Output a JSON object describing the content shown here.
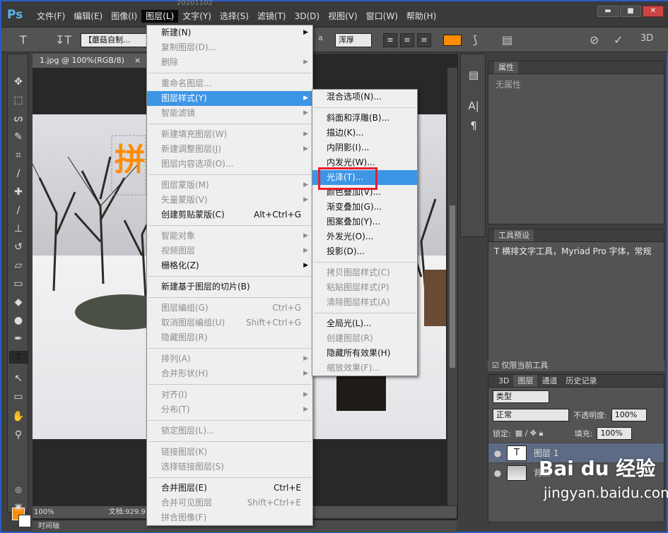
{
  "app": {
    "logo": "Ps",
    "file_ghost": "20201102"
  },
  "menubar": [
    "文件(F)",
    "编辑(E)",
    "图像(I)",
    "图层(L)",
    "文字(Y)",
    "选择(S)",
    "滤镜(T)",
    "3D(D)",
    "视图(V)",
    "窗口(W)",
    "帮助(H)"
  ],
  "window_buttons": {
    "minimize": "▬",
    "maximize": "■",
    "close": "✕"
  },
  "options": {
    "font_family": "【蘑菇自制...",
    "aa_method": "浑厚",
    "aa_label": "a",
    "swatch_color": "#ff8c00",
    "threed_label": "3D"
  },
  "document": {
    "tab_title": "1.jpg @ 100%(RGB/8)",
    "tab_close": "×",
    "canvas_text": "拼"
  },
  "status": {
    "zoom": "100%",
    "doc_info": "文档:929.9"
  },
  "timeline_label": "时间轴",
  "layer_menu": {
    "items": [
      {
        "label": "新建(N)",
        "shortcut": "",
        "arrow": true,
        "disabled": false
      },
      {
        "label": "复制图层(D)...",
        "shortcut": "",
        "arrow": false,
        "disabled": true
      },
      {
        "label": "删除",
        "shortcut": "",
        "arrow": true,
        "disabled": true
      },
      {
        "sep": true
      },
      {
        "label": "重命名图层...",
        "shortcut": "",
        "arrow": false,
        "disabled": true
      },
      {
        "label": "图层样式(Y)",
        "shortcut": "",
        "arrow": true,
        "disabled": false,
        "highlight": true
      },
      {
        "label": "智能滤镜",
        "shortcut": "",
        "arrow": true,
        "disabled": true
      },
      {
        "sep": true
      },
      {
        "label": "新建填充图层(W)",
        "shortcut": "",
        "arrow": true,
        "disabled": true
      },
      {
        "label": "新建调整图层(J)",
        "shortcut": "",
        "arrow": true,
        "disabled": true
      },
      {
        "label": "图层内容选项(O)...",
        "shortcut": "",
        "arrow": false,
        "disabled": true
      },
      {
        "sep": true
      },
      {
        "label": "图层蒙版(M)",
        "shortcut": "",
        "arrow": true,
        "disabled": true
      },
      {
        "label": "矢量蒙版(V)",
        "shortcut": "",
        "arrow": true,
        "disabled": true
      },
      {
        "label": "创建剪贴蒙版(C)",
        "shortcut": "Alt+Ctrl+G",
        "arrow": false,
        "disabled": false
      },
      {
        "sep": true
      },
      {
        "label": "智能对象",
        "shortcut": "",
        "arrow": true,
        "disabled": true
      },
      {
        "label": "视频图层",
        "shortcut": "",
        "arrow": true,
        "disabled": true
      },
      {
        "label": "栅格化(Z)",
        "shortcut": "",
        "arrow": true,
        "disabled": false
      },
      {
        "sep": true
      },
      {
        "label": "新建基于图层的切片(B)",
        "shortcut": "",
        "arrow": false,
        "disabled": false
      },
      {
        "sep": true
      },
      {
        "label": "图层编组(G)",
        "shortcut": "Ctrl+G",
        "arrow": false,
        "disabled": true
      },
      {
        "label": "取消图层编组(U)",
        "shortcut": "Shift+Ctrl+G",
        "arrow": false,
        "disabled": true
      },
      {
        "label": "隐藏图层(R)",
        "shortcut": "",
        "arrow": false,
        "disabled": true
      },
      {
        "sep": true
      },
      {
        "label": "排列(A)",
        "shortcut": "",
        "arrow": true,
        "disabled": true
      },
      {
        "label": "合并形状(H)",
        "shortcut": "",
        "arrow": true,
        "disabled": true
      },
      {
        "sep": true
      },
      {
        "label": "对齐(I)",
        "shortcut": "",
        "arrow": true,
        "disabled": true
      },
      {
        "label": "分布(T)",
        "shortcut": "",
        "arrow": true,
        "disabled": true
      },
      {
        "sep": true
      },
      {
        "label": "锁定图层(L)...",
        "shortcut": "",
        "arrow": false,
        "disabled": true
      },
      {
        "sep": true
      },
      {
        "label": "链接图层(K)",
        "shortcut": "",
        "arrow": false,
        "disabled": true
      },
      {
        "label": "选择链接图层(S)",
        "shortcut": "",
        "arrow": false,
        "disabled": true
      },
      {
        "sep": true
      },
      {
        "label": "合并图层(E)",
        "shortcut": "Ctrl+E",
        "arrow": false,
        "disabled": false
      },
      {
        "label": "合并可见图层",
        "shortcut": "Shift+Ctrl+E",
        "arrow": false,
        "disabled": true
      },
      {
        "label": "拼合图像(F)",
        "shortcut": "",
        "arrow": false,
        "disabled": true
      }
    ]
  },
  "style_submenu": {
    "items": [
      {
        "label": "混合选项(N)...",
        "disabled": false
      },
      {
        "sep": true
      },
      {
        "label": "斜面和浮雕(B)...",
        "disabled": false
      },
      {
        "label": "描边(K)...",
        "disabled": false
      },
      {
        "label": "内阴影(I)...",
        "disabled": false
      },
      {
        "label": "内发光(W)...",
        "disabled": false
      },
      {
        "label": "光泽(T)...",
        "disabled": false,
        "highlight": true
      },
      {
        "label": "颜色叠加(V)...",
        "disabled": false
      },
      {
        "label": "渐变叠加(G)...",
        "disabled": false
      },
      {
        "label": "图案叠加(Y)...",
        "disabled": false
      },
      {
        "label": "外发光(O)...",
        "disabled": false
      },
      {
        "label": "投影(D)...",
        "disabled": false
      },
      {
        "sep": true
      },
      {
        "label": "拷贝图层样式(C)",
        "disabled": true
      },
      {
        "label": "粘贴图层样式(P)",
        "disabled": true
      },
      {
        "label": "清除图层样式(A)",
        "disabled": true
      },
      {
        "sep": true
      },
      {
        "label": "全局光(L)...",
        "disabled": false
      },
      {
        "label": "创建图层(R)",
        "disabled": true
      },
      {
        "label": "隐藏所有效果(H)",
        "disabled": false
      },
      {
        "label": "缩放效果(F)...",
        "disabled": true
      }
    ]
  },
  "properties_panel": {
    "title": "属性",
    "empty_text": "无属性"
  },
  "presets_panel": {
    "title": "工具预设",
    "row_icon": "T",
    "row_text": "横排文字工具，Myriad Pro 字体，常规"
  },
  "presets_footer": {
    "checkbox_label": "仅限当前工具"
  },
  "layers_panel": {
    "tabs": [
      "3D",
      "图层",
      "通道",
      "历史记录"
    ],
    "filter_label": "类型",
    "blend_mode": "正常",
    "opacity_label": "不透明度:",
    "opacity_value": "100%",
    "lock_label": "锁定:",
    "fill_label": "填充:",
    "fill_value": "100%",
    "layers": [
      {
        "name": "图层 1",
        "thumb": "T",
        "active": true
      },
      {
        "name": "背景",
        "thumb": "",
        "active": false
      }
    ]
  },
  "watermark": {
    "brand": "Bai du 经验",
    "url": "jingyan.baidu.com"
  }
}
